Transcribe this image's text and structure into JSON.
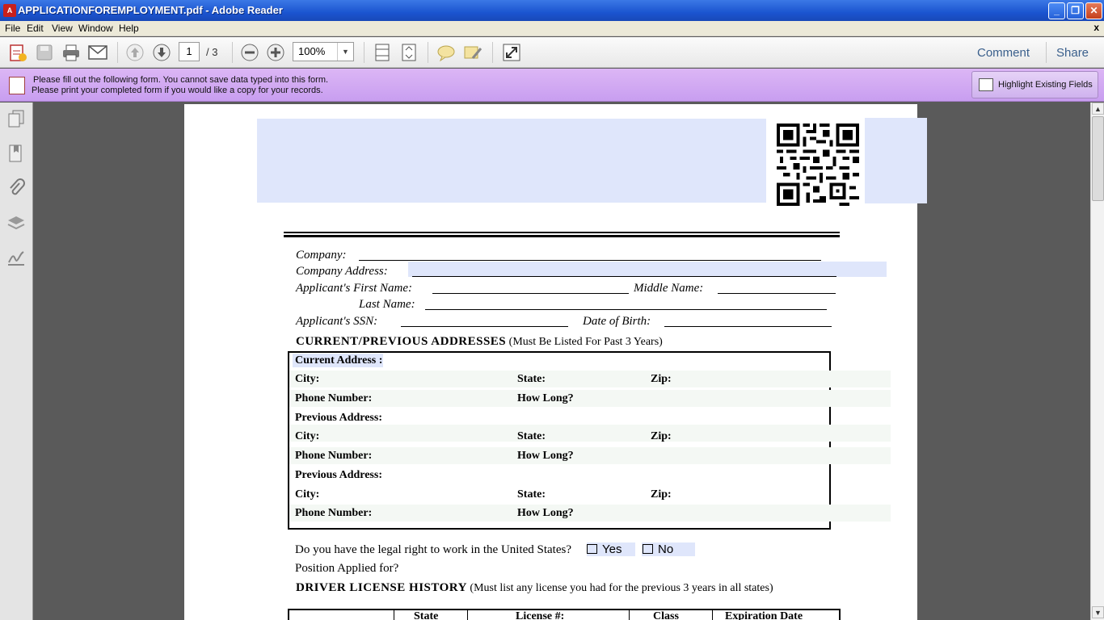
{
  "window": {
    "title": "APPLICATIONFOREMPLOYMENT.pdf - Adobe Reader",
    "app_icon_glyph": "A",
    "buttons": {
      "minimize": "_",
      "maximize": "❐",
      "close": "✕"
    }
  },
  "menu": {
    "items": [
      "File",
      "Edit",
      "View",
      "Window",
      "Help"
    ],
    "close_glyph": "x"
  },
  "toolbar": {
    "current_page": "1",
    "page_count": "/ 3",
    "zoom": "100%",
    "comment_label": "Comment",
    "share_label": "Share",
    "icons": [
      "create-pdf-icon",
      "save-icon",
      "print-icon",
      "email-icon",
      "previous-page-icon",
      "next-page-icon",
      "zoom-out-icon",
      "zoom-in-icon",
      "fit-width-icon",
      "fit-page-icon",
      "sticky-note-icon",
      "highlight-text-icon",
      "fullscreen-icon"
    ]
  },
  "form_bar": {
    "message_line1": "Please fill out the following form. You cannot save data typed into this form.",
    "message_line2": "Please print your completed form if you would like a copy for your records.",
    "highlight_button": "Highlight Existing Fields"
  },
  "left_nav": {
    "icons": [
      "pages-icon",
      "bookmarks-icon",
      "attachments-icon",
      "layers-icon",
      "signatures-icon"
    ]
  },
  "colors": {
    "field_fill": "#dfe6fb",
    "form_bar": "#d4aef3",
    "titlebar": "#1f5bd6",
    "link": "#3a5f8c"
  },
  "document": {
    "company_label": "Company:",
    "company_address_label": "Company Address:",
    "first_name_label": "Applicant's First Name:",
    "middle_name_label": "Middle Name:",
    "last_name_label": "Last Name:",
    "ssn_label": "Applicant's  SSN:",
    "dob_label": "Date of Birth:",
    "addresses_heading": "CURRENT/PREVIOUS ADDRESSES",
    "addresses_note": "(Must Be Listed For Past 3 Years)",
    "current_address_label": "Current Address :",
    "previous_address_label": "Previous Address:",
    "city_label": "City:",
    "state_label": "State:",
    "zip_label": "Zip:",
    "phone_label": "Phone Number:",
    "how_long_label": "How Long?",
    "work_right_question": "Do you have the legal right to work in the United States?",
    "yes_label": "Yes",
    "no_label": "No",
    "position_label": "Position Applied for?",
    "license_heading": "DRIVER LICENSE HISTORY",
    "license_note": "(Must list any license you had for the previous 3 years in all states)",
    "license_columns": [
      "",
      "State",
      "License #:",
      "Class",
      "Expiration Date"
    ]
  }
}
